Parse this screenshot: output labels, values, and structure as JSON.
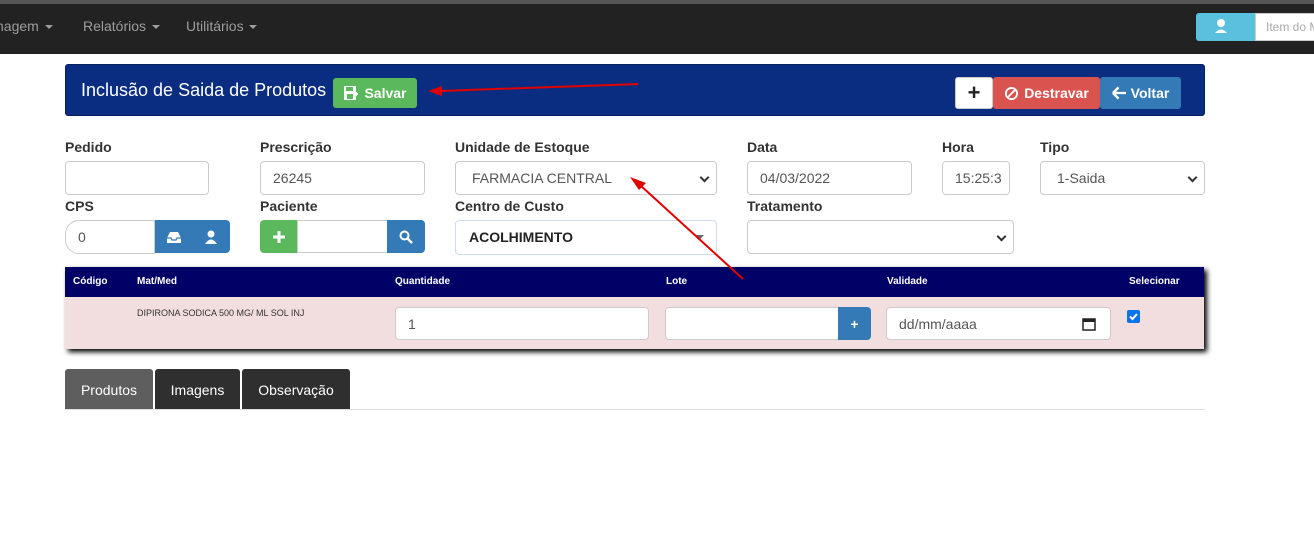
{
  "nav": {
    "items": [
      "nagem",
      "Relatórios",
      "Utilitários"
    ],
    "search_placeholder": "Item do M"
  },
  "panel": {
    "title": "Inclusão de Saida de Produtos",
    "save_label": "Salvar",
    "add_label": "+",
    "unlock_label": "Destravar",
    "back_label": "Voltar"
  },
  "form": {
    "pedido": {
      "label": "Pedido",
      "value": ""
    },
    "prescricao": {
      "label": "Prescrição",
      "value": "26245"
    },
    "unidade": {
      "label": "Unidade de Estoque",
      "value": "FARMACIA CENTRAL"
    },
    "data": {
      "label": "Data",
      "value": "04/03/2022"
    },
    "hora": {
      "label": "Hora",
      "value": "15:25:3"
    },
    "tipo": {
      "label": "Tipo",
      "value": "1-Saida"
    },
    "cps": {
      "label": "CPS",
      "value": "0"
    },
    "paciente": {
      "label": "Paciente",
      "value": ""
    },
    "centro_custo": {
      "label": "Centro de Custo",
      "value": "ACOLHIMENTO"
    },
    "tratamento": {
      "label": "Tratamento",
      "value": ""
    }
  },
  "table": {
    "headers": [
      "Código",
      "Mat/Med",
      "Quantidade",
      "Lote",
      "Validade",
      "Selecionar"
    ],
    "rows": [
      {
        "codigo": "",
        "matmed": "DIPIRONA SODICA 500 MG/ ML SOL INJ",
        "quantidade": "1",
        "lote": "",
        "validade_placeholder": "dd/mm/aaaa",
        "lote_add": "+",
        "selected": true
      }
    ]
  },
  "tabs": [
    "Produtos",
    "Imagens",
    "Observação"
  ],
  "colors": {
    "navbar": "#222222",
    "panel": "#0a2d82",
    "success": "#5cb85c",
    "danger": "#d9534f",
    "primary": "#337ab7",
    "info": "#5bc0de",
    "table_header": "#000066",
    "row_bg": "#f2dede",
    "annotation_arrow": "#e00000"
  }
}
